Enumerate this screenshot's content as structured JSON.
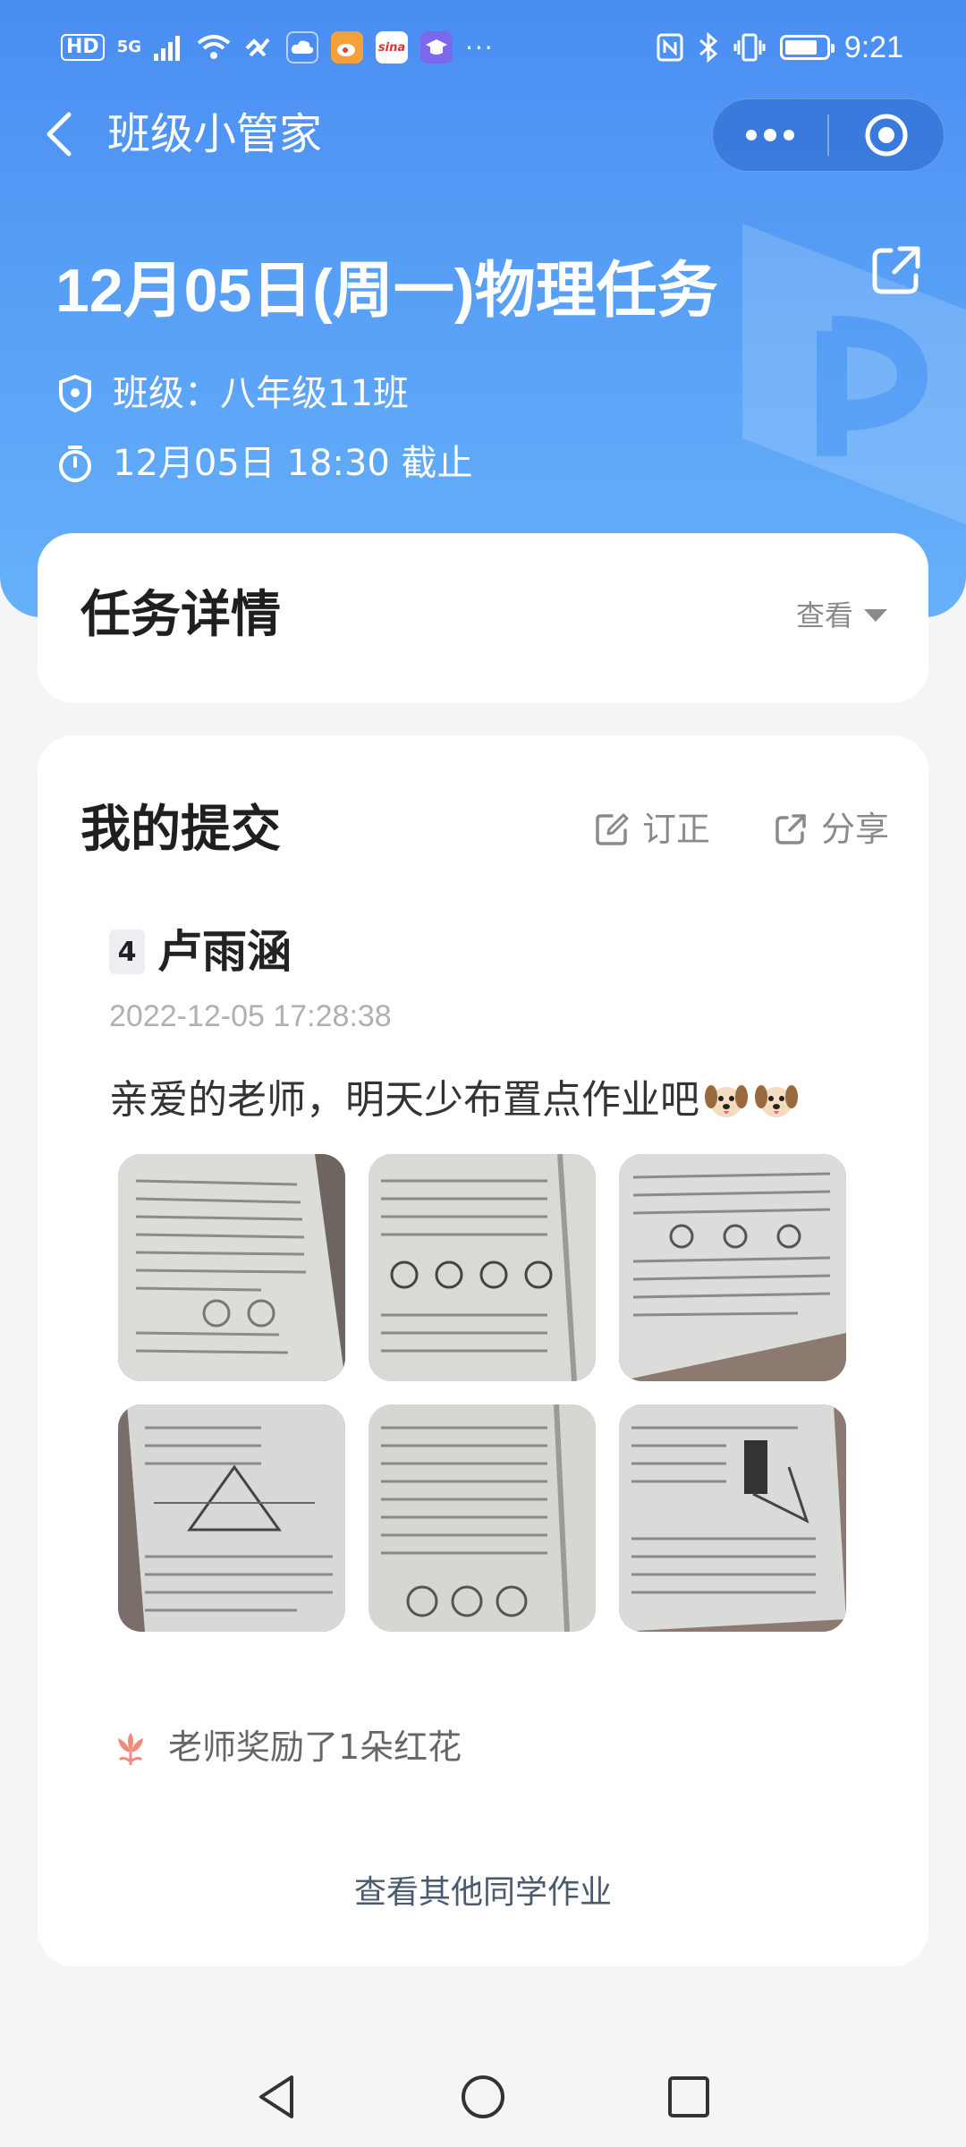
{
  "status_bar": {
    "left_hd": "HD",
    "left_net": "5G",
    "more": "···",
    "time": "9:21",
    "app_icons": [
      "cloud-icon",
      "weibo-icon",
      "sina-icon",
      "graduation-icon"
    ]
  },
  "navbar": {
    "title": "班级小管家"
  },
  "task": {
    "title": "12月05日(周一)物理任务",
    "class_line": "班级：八年级11班",
    "deadline": "12月05日 18:30 截止"
  },
  "detail_card": {
    "heading": "任务详情",
    "view_label": "查看"
  },
  "submission_card": {
    "heading": "我的提交",
    "fix_label": "订正",
    "share_label": "分享",
    "student_number": "4",
    "student_name": "卢雨涵",
    "timestamp": "2022-12-05 17:28:38",
    "message": "亲爱的老师，明天少布置点作业吧",
    "reward": "老师奖励了1朵红花",
    "view_others": "查看其他同学作业"
  },
  "colors": {
    "header_blue": "#4a8df2",
    "card_bg": "#ffffff",
    "page_bg": "#f4f5f7",
    "flower": "#f08a7c"
  }
}
